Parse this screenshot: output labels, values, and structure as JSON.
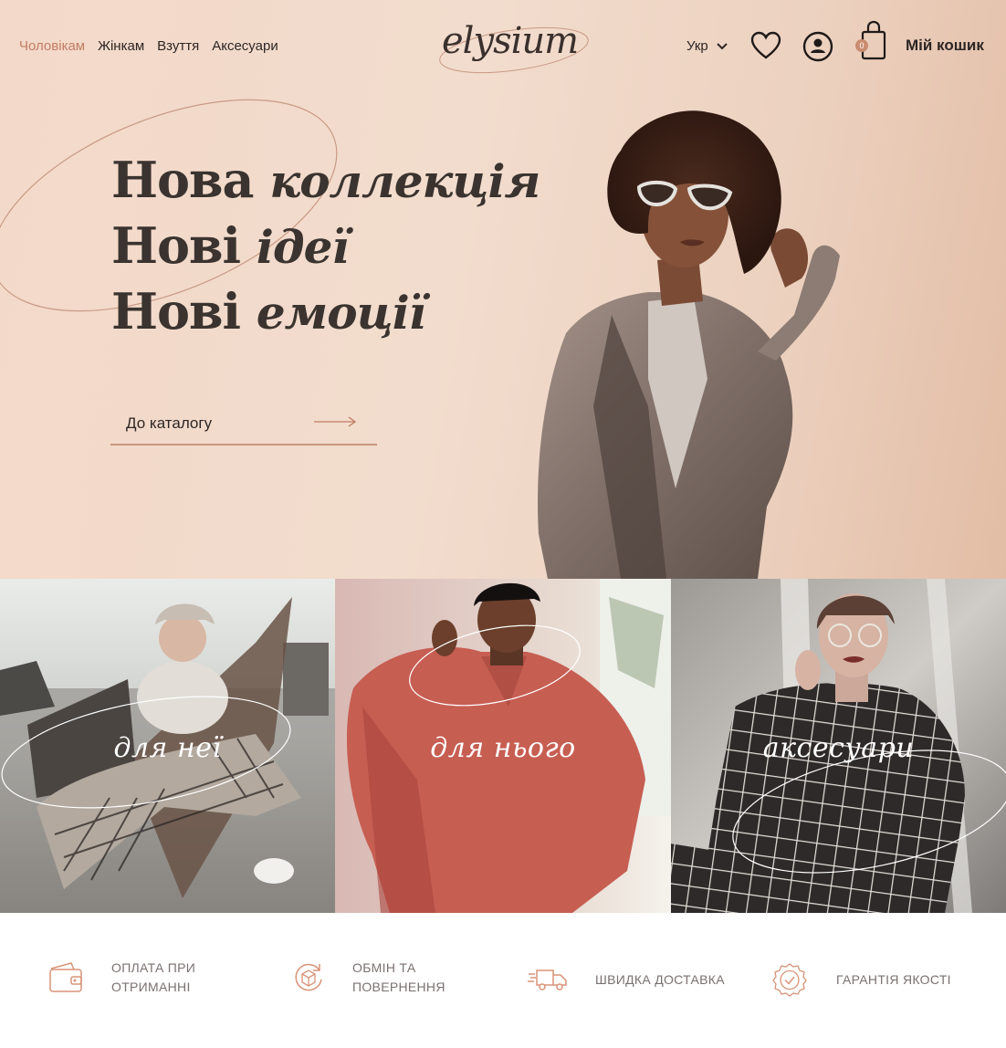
{
  "nav": {
    "items": [
      "Чоловікам",
      "Жінкам",
      "Взуття",
      "Аксесуари"
    ]
  },
  "brand": {
    "logo": "elysium"
  },
  "header": {
    "language": "Укр",
    "cart_count": "0",
    "cart_label": "Мій кошик"
  },
  "hero": {
    "line1_a": "Нова ",
    "line1_b": "коллекція",
    "line2_a": "Нові ",
    "line2_b": "ідеї",
    "line3_a": "Нові ",
    "line3_b": "емоції",
    "cta": "До каталогу"
  },
  "categories": [
    {
      "label": "для неї"
    },
    {
      "label": "для нього"
    },
    {
      "label": "аксесуари"
    }
  ],
  "features": [
    {
      "line1": "ОПЛАТА ПРИ",
      "line2": "ОТРИМАННІ",
      "icon": "wallet-icon"
    },
    {
      "line1": "ОБМІН ТА",
      "line2": "ПОВЕРНЕННЯ",
      "icon": "return-box-icon"
    },
    {
      "line1": "ШВИДКА ДОСТАВКА",
      "line2": "",
      "icon": "delivery-truck-icon"
    },
    {
      "line1": "ГАРАНТІЯ ЯКОСТІ",
      "line2": "",
      "icon": "quality-badge-icon"
    }
  ],
  "colors": {
    "accent": "#c27d62",
    "hero_bg": "#f2dccd",
    "text": "#2d2624",
    "muted": "#7a7170"
  }
}
